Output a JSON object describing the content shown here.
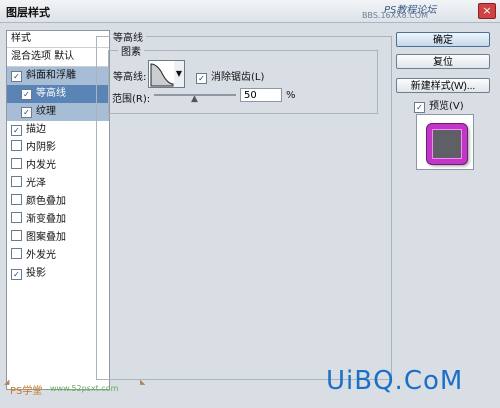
{
  "window": {
    "title": "图层样式",
    "watermark_top_line1": "PS教程论坛",
    "watermark_top_line2": "BBS.16XX8.COM",
    "close_label": "×"
  },
  "style_list": {
    "header": "样式",
    "blend_options": "混合选项 默认",
    "items": [
      {
        "label": "斜面和浮雕",
        "checked": true
      },
      {
        "label": "等高线",
        "checked": true
      },
      {
        "label": "纹理",
        "checked": true
      },
      {
        "label": "描边",
        "checked": true
      },
      {
        "label": "内阴影",
        "checked": false
      },
      {
        "label": "内发光",
        "checked": false
      },
      {
        "label": "光泽",
        "checked": false
      },
      {
        "label": "颜色叠加",
        "checked": false
      },
      {
        "label": "渐变叠加",
        "checked": false
      },
      {
        "label": "图案叠加",
        "checked": false
      },
      {
        "label": "外发光",
        "checked": false
      },
      {
        "label": "投影",
        "checked": true
      }
    ],
    "check_glyph": "✓"
  },
  "contour_panel": {
    "section_title": "等高线",
    "group_title": "图素",
    "contour_label": "等高线:",
    "anti_alias_label": "消除锯齿(L)",
    "anti_alias_checked": true,
    "range_label": "范围(R):",
    "range_value": "50",
    "range_unit": "%",
    "range_percent": 50
  },
  "buttons": {
    "ok": "确定",
    "reset": "复位",
    "new_style": "新建样式(W)...",
    "preview_label": "预览(V)",
    "preview_checked": true
  },
  "watermarks": {
    "bottom_right": "UiBQ.CoM",
    "bottom_left": "PS学堂",
    "bottom_left_url": "www.52psxt.com"
  },
  "icons": {
    "dropdown": "chevron-down-icon",
    "slider_thumb": "triangle-up-icon",
    "checkbox": "checkbox-icon"
  },
  "colors": {
    "selection": "#a7bdd6",
    "subselection": "#5a83b6",
    "preview_stroke": "#c236c8"
  }
}
